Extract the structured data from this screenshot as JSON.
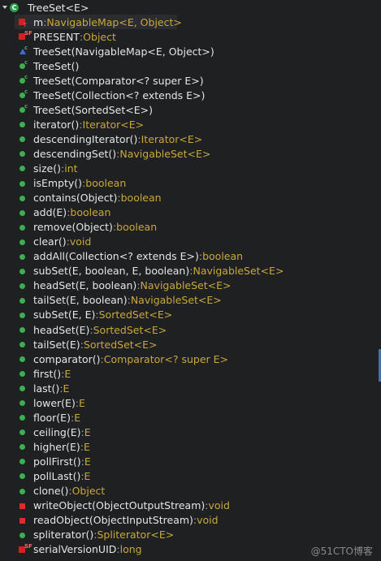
{
  "root": {
    "label": "TreeSet<E>",
    "icon": "class-icon",
    "icon_letter": "C"
  },
  "members": [
    {
      "icon": "field-private-transient",
      "name": "m",
      "sep": " : ",
      "type": "NavigableMap<E, Object>",
      "selected": true
    },
    {
      "icon": "field-private-static-final",
      "name": "PRESENT",
      "sep": " : ",
      "type": "Object"
    },
    {
      "icon": "constructor-package",
      "name": "TreeSet(NavigableMap<E, Object>)",
      "sep": "",
      "type": ""
    },
    {
      "icon": "constructor-public",
      "name": "TreeSet()",
      "sep": "",
      "type": ""
    },
    {
      "icon": "constructor-public",
      "name": "TreeSet(Comparator<? super E>)",
      "sep": "",
      "type": ""
    },
    {
      "icon": "constructor-public",
      "name": "TreeSet(Collection<? extends E>)",
      "sep": "",
      "type": ""
    },
    {
      "icon": "constructor-public",
      "name": "TreeSet(SortedSet<E>)",
      "sep": "",
      "type": ""
    },
    {
      "icon": "method-public",
      "name": "iterator()",
      "sep": " : ",
      "type": "Iterator<E>"
    },
    {
      "icon": "method-public",
      "name": "descendingIterator()",
      "sep": " : ",
      "type": "Iterator<E>"
    },
    {
      "icon": "method-public",
      "name": "descendingSet()",
      "sep": " : ",
      "type": "NavigableSet<E>"
    },
    {
      "icon": "method-public",
      "name": "size()",
      "sep": " : ",
      "type": "int"
    },
    {
      "icon": "method-public",
      "name": "isEmpty()",
      "sep": " : ",
      "type": "boolean"
    },
    {
      "icon": "method-public",
      "name": "contains(Object)",
      "sep": " : ",
      "type": "boolean"
    },
    {
      "icon": "method-public",
      "name": "add(E)",
      "sep": " : ",
      "type": "boolean"
    },
    {
      "icon": "method-public",
      "name": "remove(Object)",
      "sep": " : ",
      "type": "boolean"
    },
    {
      "icon": "method-public",
      "name": "clear()",
      "sep": " : ",
      "type": "void"
    },
    {
      "icon": "method-public",
      "name": "addAll(Collection<? extends E>)",
      "sep": " : ",
      "type": "boolean"
    },
    {
      "icon": "method-public",
      "name": "subSet(E, boolean, E, boolean)",
      "sep": " : ",
      "type": "NavigableSet<E>"
    },
    {
      "icon": "method-public",
      "name": "headSet(E, boolean)",
      "sep": " : ",
      "type": "NavigableSet<E>"
    },
    {
      "icon": "method-public",
      "name": "tailSet(E, boolean)",
      "sep": " : ",
      "type": "NavigableSet<E>"
    },
    {
      "icon": "method-public",
      "name": "subSet(E, E)",
      "sep": " : ",
      "type": "SortedSet<E>"
    },
    {
      "icon": "method-public",
      "name": "headSet(E)",
      "sep": " : ",
      "type": "SortedSet<E>"
    },
    {
      "icon": "method-public",
      "name": "tailSet(E)",
      "sep": " : ",
      "type": "SortedSet<E>"
    },
    {
      "icon": "method-public",
      "name": "comparator()",
      "sep": " : ",
      "type": "Comparator<? super E>"
    },
    {
      "icon": "method-public",
      "name": "first()",
      "sep": " : ",
      "type": "E"
    },
    {
      "icon": "method-public",
      "name": "last()",
      "sep": " : ",
      "type": "E"
    },
    {
      "icon": "method-public",
      "name": "lower(E)",
      "sep": " : ",
      "type": "E"
    },
    {
      "icon": "method-public",
      "name": "floor(E)",
      "sep": " : ",
      "type": "E"
    },
    {
      "icon": "method-public",
      "name": "ceiling(E)",
      "sep": " : ",
      "type": "E"
    },
    {
      "icon": "method-public",
      "name": "higher(E)",
      "sep": " : ",
      "type": "E"
    },
    {
      "icon": "method-public",
      "name": "pollFirst()",
      "sep": " : ",
      "type": "E"
    },
    {
      "icon": "method-public",
      "name": "pollLast()",
      "sep": " : ",
      "type": "E"
    },
    {
      "icon": "method-public",
      "name": "clone()",
      "sep": " : ",
      "type": "Object"
    },
    {
      "icon": "method-private",
      "name": "writeObject(ObjectOutputStream)",
      "sep": " : ",
      "type": "void"
    },
    {
      "icon": "method-private",
      "name": "readObject(ObjectInputStream)",
      "sep": " : ",
      "type": "void"
    },
    {
      "icon": "method-public",
      "name": "spliterator()",
      "sep": " : ",
      "type": "Spliterator<E>"
    },
    {
      "icon": "field-private-static-final",
      "name": "serialVersionUID",
      "sep": " : ",
      "type": "long"
    }
  ],
  "watermark": "@51CTO博客",
  "colors": {
    "background": "#1f2022",
    "text": "#e6e6e6",
    "type": "#c9a83a",
    "public": "#3cb050",
    "private": "#e02b2b",
    "package": "#3a6fd8"
  }
}
